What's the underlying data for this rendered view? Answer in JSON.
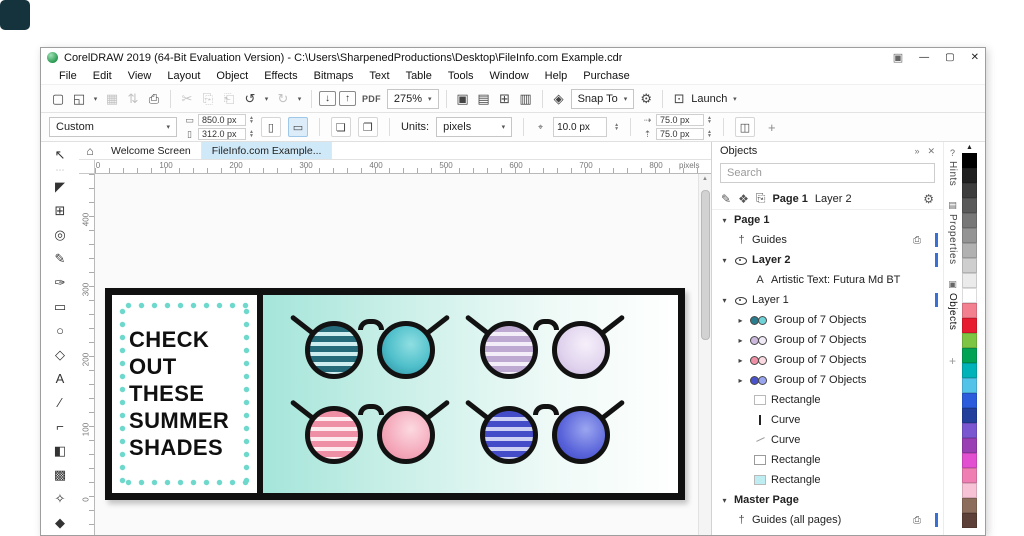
{
  "window": {
    "title": "CorelDRAW 2019 (64-Bit Evaluation Version) - C:\\Users\\SharpenedProductions\\Desktop\\FileInfo.com Example.cdr"
  },
  "icons": {
    "min": "—",
    "max": "▢",
    "close": "✕",
    "gallery": "▣",
    "caret": "▾",
    "new": "▢",
    "open": "◱",
    "save": "▦",
    "updown": "⇅",
    "print": "⎙",
    "cut": "✂",
    "copy": "⎘",
    "paste": "⎗",
    "undo": "↺",
    "redo": "↻",
    "import": "↓",
    "export": "↑",
    "preview": "▣",
    "view1": "▤",
    "view2": "▥",
    "view3": "⊞",
    "snap": "◈",
    "gear": "⚙",
    "launch": "⊡",
    "width": "▭",
    "height": "▯",
    "portrait": "▯",
    "landscape": "▭",
    "pages1": "❏",
    "pages2": "❐",
    "nudge": "⌖",
    "dupx": "⇢",
    "dupy": "⇡",
    "fillmode": "◫",
    "plus": "+",
    "home": "⌂",
    "collapse": "»",
    "docker_close": "✕",
    "hdr1": "✎",
    "hdr2": "❖",
    "hdr3": "⎘",
    "tw_open": "▾",
    "tw_closed": "▸",
    "guides": "†",
    "text_obj": "A",
    "printer": "⎙",
    "scroll_up": "▲",
    "dots": "⋯",
    "hints_icon": "?",
    "props_icon": "▤",
    "objects_icon": "▣"
  },
  "menu": {
    "items": [
      "File",
      "Edit",
      "View",
      "Layout",
      "Object",
      "Effects",
      "Bitmaps",
      "Text",
      "Table",
      "Tools",
      "Window",
      "Help",
      "Purchase"
    ]
  },
  "toolbar": {
    "zoom": "275%",
    "pdf": "PDF",
    "snap_label": "Snap To",
    "launch_label": "Launch"
  },
  "propbar": {
    "preset": "Custom",
    "page_width": "850.0 px",
    "page_height": "312.0 px",
    "units_label": "Units:",
    "units": "pixels",
    "nudge": "10.0 px",
    "dup1": "75.0 px",
    "dup2": "75.0 px"
  },
  "tabs": {
    "items": [
      "Welcome Screen",
      "FileInfo.com Example..."
    ]
  },
  "ruler": {
    "h": [
      "0",
      "100",
      "200",
      "300",
      "400",
      "500",
      "600",
      "700",
      "800"
    ],
    "unit": "pixels",
    "v": [
      "400",
      "300",
      "200",
      "100",
      "0"
    ]
  },
  "toolbox": {
    "tools": [
      {
        "name": "pick",
        "glyph": "↖"
      },
      {
        "name": "shape",
        "glyph": "◤"
      },
      {
        "name": "crop",
        "glyph": "⊞"
      },
      {
        "name": "zoom",
        "glyph": "◎"
      },
      {
        "name": "freehand",
        "glyph": "✎"
      },
      {
        "name": "artistic-media",
        "glyph": "✑"
      },
      {
        "name": "rectangle",
        "glyph": "▭"
      },
      {
        "name": "ellipse",
        "glyph": "○"
      },
      {
        "name": "polygon",
        "glyph": "◇"
      },
      {
        "name": "text",
        "glyph": "A"
      },
      {
        "name": "dimension",
        "glyph": "∕"
      },
      {
        "name": "connector",
        "glyph": "⌐"
      },
      {
        "name": "interactive-fill",
        "glyph": "◧"
      },
      {
        "name": "mesh-fill",
        "glyph": "▩"
      },
      {
        "name": "eyedropper",
        "glyph": "✧"
      },
      {
        "name": "outline-pen",
        "glyph": "◆"
      }
    ]
  },
  "artwork": {
    "headline": "CHECK\nOUT\nTHESE\nSUMMER\nSHADES",
    "dot_color": "#6fd8cc",
    "dots_h": "radial-gradient(circle, #6fd8cc 2.4px, transparent 3px) 2px 50%/13px 7px repeat-x",
    "dots_v": "radial-gradient(circle, #6fd8cc 2.4px, transparent 3px) 50% 2px/7px 13px repeat-y",
    "panel_gradient": "linear-gradient(90deg,#a5e5da 0%,#cdf0e9 35%,#effaf7 70%,#ffffff 100%)",
    "pairs": [
      {
        "stripes": "repeating-linear-gradient(180deg,#256b7a 0 6px,#cfeef0 6px 10px)",
        "solid": "radial-gradient(circle at 60% 38%,#8fdfe2 0%,#4fbfca 55%,#2a8a9e 100%)"
      },
      {
        "stripes": "repeating-linear-gradient(180deg,#bda9d2 0 6px,#f3eef8 6px 10px)",
        "solid": "radial-gradient(circle at 60% 38%,#f6f0fa 0%,#e0d3ee 60%,#c9b6dc 100%)"
      },
      {
        "stripes": "repeating-linear-gradient(180deg,#ee8fa6 0 6px,#fdebf0 6px 10px)",
        "solid": "radial-gradient(circle at 60% 38%,#fcd9e0 0%,#f4a8ba 60%,#ea8ba4 100%)"
      },
      {
        "stripes": "repeating-linear-gradient(180deg,#444cc8 0 6px,#ccd0f4 6px 10px)",
        "solid": "radial-gradient(circle at 60% 38%,#9ba6f0 0%,#5a64da 60%,#3a42bd 100%)"
      }
    ]
  },
  "docker": {
    "title": "Objects",
    "search_placeholder": "Search",
    "current_page": "Page 1",
    "current_layer": "Layer 2",
    "rows": [
      {
        "label": "Page 1"
      },
      {
        "label": "Guides"
      },
      {
        "label": "Layer 2"
      },
      {
        "label": "Artistic Text: Futura Md BT"
      },
      {
        "label": "Layer 1"
      },
      {
        "label": "Group of 7 Objects",
        "c1": "#2a7d8c",
        "c2": "#6fd3d8"
      },
      {
        "label": "Group of 7 Objects",
        "c1": "#cbb8dc",
        "c2": "#f0e9f6"
      },
      {
        "label": "Group of 7 Objects",
        "c1": "#ee8fa6",
        "c2": "#fbd9e1"
      },
      {
        "label": "Group of 7 Objects",
        "c1": "#4a52cc",
        "c2": "#9aa5ef"
      },
      {
        "label": "Rectangle"
      },
      {
        "label": "Curve"
      },
      {
        "label": "Curve"
      },
      {
        "label": "Rectangle"
      },
      {
        "label": "Rectangle",
        "c1": "#bfeef2"
      },
      {
        "label": "Master Page"
      },
      {
        "label": "Guides (all pages)"
      }
    ],
    "accent": "#3a6fd4"
  },
  "side_tabs": {
    "items": [
      "Hints",
      "Properties",
      "Objects"
    ]
  },
  "palette": {
    "colors": [
      "#000000",
      "#202020",
      "#3d3d3d",
      "#5a5a5a",
      "#777777",
      "#949494",
      "#b1b1b1",
      "#cecece",
      "#ebebeb",
      "#ffffff",
      "#f2808f",
      "#e81c30",
      "#7ec544",
      "#00a254",
      "#00b3b8",
      "#53c3ea",
      "#2a5cdb",
      "#223f9b",
      "#7a57d1",
      "#993fb3",
      "#e24fd0",
      "#ef7fb3",
      "#f7c2d6",
      "#8d6e5c",
      "#5d4037"
    ]
  }
}
